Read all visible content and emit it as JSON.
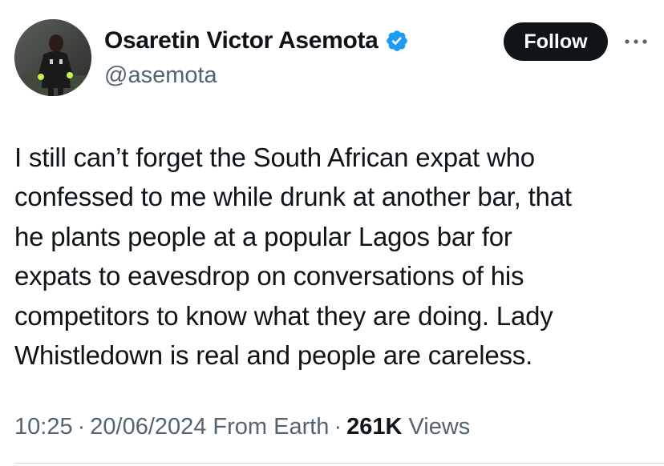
{
  "author": {
    "display_name": "Osaretin Victor Asemota",
    "handle": "@asemota",
    "verified": true
  },
  "actions": {
    "follow_label": "Follow",
    "more_icon": "more-horizontal-icon"
  },
  "tweet": {
    "lines": [
      "I still can’t forget the South African expat who",
      "confessed to me while drunk at another bar, that",
      "he plants people at a popular Lagos bar for",
      "expats to eavesdrop on conversations of  his",
      "competitors to know what they are doing. Lady",
      "Whistledown is real and people are careless."
    ]
  },
  "meta": {
    "time": "10:25",
    "date": "20/06/2024",
    "source": "From Earth",
    "separator": "·",
    "views_count": "261K",
    "views_label": "Views"
  },
  "colors": {
    "text": "#0f1419",
    "secondary": "#536471",
    "verified_blue": "#1d9bf0",
    "follow_bg": "#0f1419",
    "divider": "#cfd9de"
  }
}
